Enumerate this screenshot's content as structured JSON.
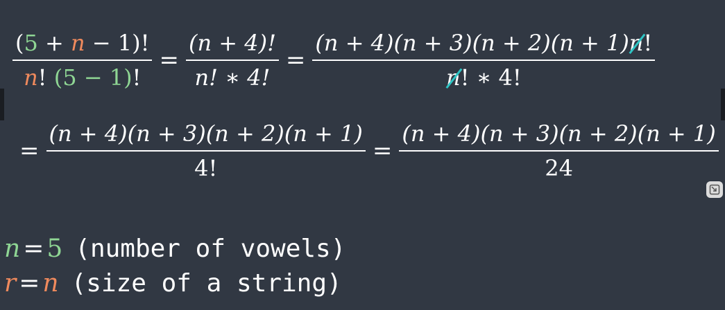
{
  "equation_line_1": {
    "frac1": {
      "num_open": "(",
      "num_five": "5",
      "num_plus": " + ",
      "num_n": "n",
      "num_rest": " − 1)!",
      "den_n": "n",
      "den_bang": "! ",
      "den_group": "(5 − 1)",
      "den_end": "!"
    },
    "eq1": "=",
    "frac2": {
      "num": "(n + 4)!",
      "den": "n! ∗ 4!"
    },
    "eq2": "=",
    "frac3": {
      "num_main": "(n + 4)(n + 3)(n + 2)(n + 1)",
      "num_cancelled": "n",
      "num_end": "!",
      "den_cancelled": "n",
      "den_end": "! ∗ 4!"
    }
  },
  "equation_line_2": {
    "eq1": "=",
    "frac1": {
      "num": "(n + 4)(n + 3)(n + 2)(n + 1)",
      "den": "4!"
    },
    "eq2": "=",
    "frac2": {
      "num": "(n + 4)(n + 3)(n + 2)(n + 1)",
      "den": "24"
    }
  },
  "definitions": {
    "n_var": "n",
    "n_eq": "=",
    "n_value": "5",
    "n_desc": "(number of vowels)",
    "r_var": "r",
    "r_eq": "=",
    "r_value": "n",
    "r_desc": "(size of a string)"
  },
  "colors": {
    "background": "#313843",
    "text": "#ffffff",
    "green": "#8fd694",
    "orange": "#f08a5d",
    "cancel_stroke": "#2ec4c4"
  },
  "icons": {
    "resize": "resize-icon"
  }
}
